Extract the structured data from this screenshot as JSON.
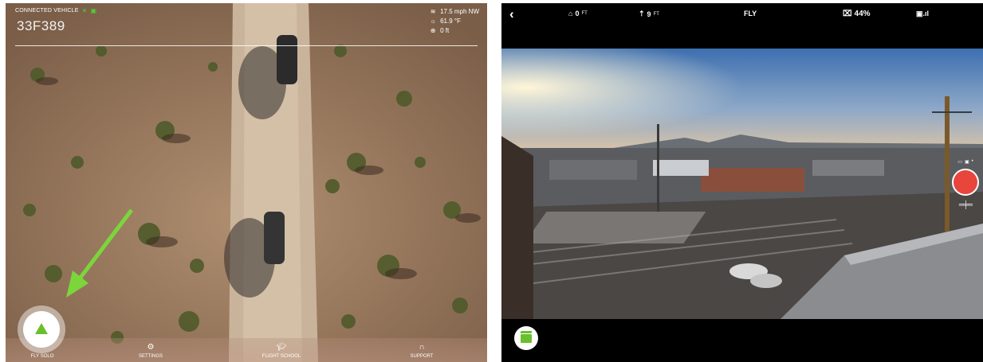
{
  "left": {
    "connection_label": "CONNECTED VEHICLE",
    "vehicle_id": "33F389",
    "weather": {
      "wind": "17.5 mph NW",
      "temperature": "61.9 °F",
      "altitude": "0 ft"
    },
    "nav": [
      {
        "label": "FLY SOLO",
        "icon": "drone-arrow-icon"
      },
      {
        "label": "SETTINGS",
        "icon": "gear-icon"
      },
      {
        "label": "FLIGHT SCHOOL",
        "icon": "graduation-cap-icon"
      },
      {
        "label": "SUPPORT",
        "icon": "headset-icon"
      }
    ],
    "colors": {
      "accent": "#6abf2e"
    }
  },
  "right": {
    "home_distance": "0",
    "altitude": "9",
    "unit": "FT",
    "mode": "FLY",
    "battery": "44%",
    "colors": {
      "record": "#e8453c",
      "accent": "#6abf2e"
    }
  }
}
